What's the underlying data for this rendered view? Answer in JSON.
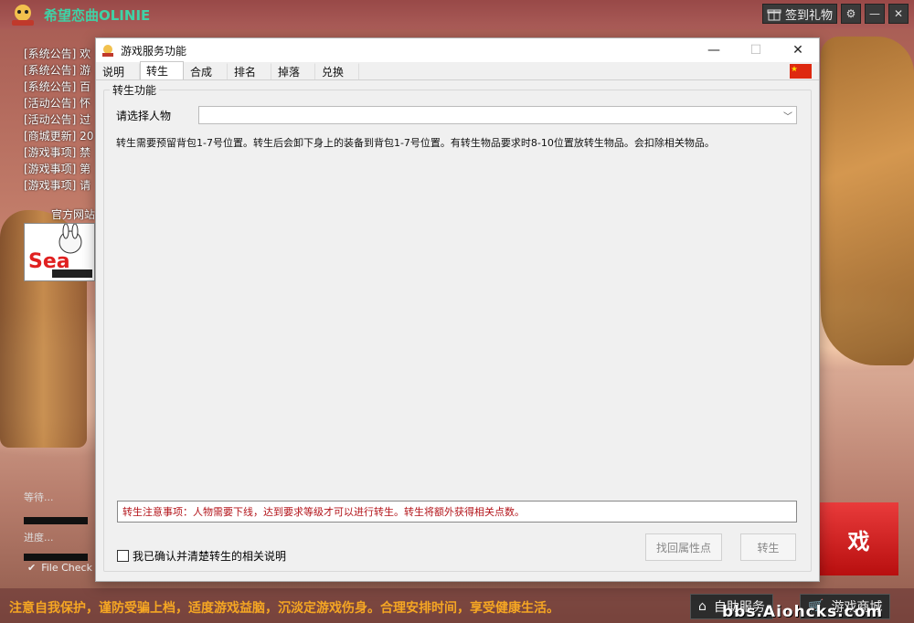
{
  "app": {
    "title": "希望恋曲OLINIE",
    "gift_label": "签到礼物"
  },
  "notices": [
    "[系统公告] 欢",
    "[系统公告] 游",
    "[系统公告] 百",
    "[活动公告] 怀",
    "[活动公告] 过",
    "[商城更新] 20",
    "[游戏事项] 禁",
    "[游戏事项] 第",
    "[游戏事项] 请"
  ],
  "official_site": "官方网站",
  "ad_text": "Sea Online",
  "bottom_left": {
    "label1": "等待...",
    "label2": "进度...",
    "file_check": "File Check"
  },
  "red_button": "戏",
  "footer": {
    "text": "注意自我保护，谨防受骗上档，适度游戏益脑，沉淡定游戏伤身。合理安排时间，享受健康生活。",
    "self_service": "自助服务",
    "shop": "游戏商城",
    "watermark": "bbs.Aiohcks.com"
  },
  "dialog": {
    "title": "游戏服务功能",
    "tabs": [
      "说明",
      "转生",
      "合成",
      "排名",
      "掉落",
      "兑换"
    ],
    "active_tab": "转生",
    "group_title": "转生功能",
    "select_label": "请选择人物",
    "select_value": "",
    "description": "转生需要预留背包1-7号位置。转生后会卸下身上的装备到背包1-7号位置。有转生物品要求时8-10位置放转生物品。会扣除相关物品。",
    "notice": "转生注意事项：人物需要下线，达到要求等级才可以进行转生。转生将额外获得相关点数。",
    "confirm_label": "我已确认并清楚转生的相关说明",
    "btn_recover": "找回属性点",
    "btn_rebirth": "转生"
  }
}
